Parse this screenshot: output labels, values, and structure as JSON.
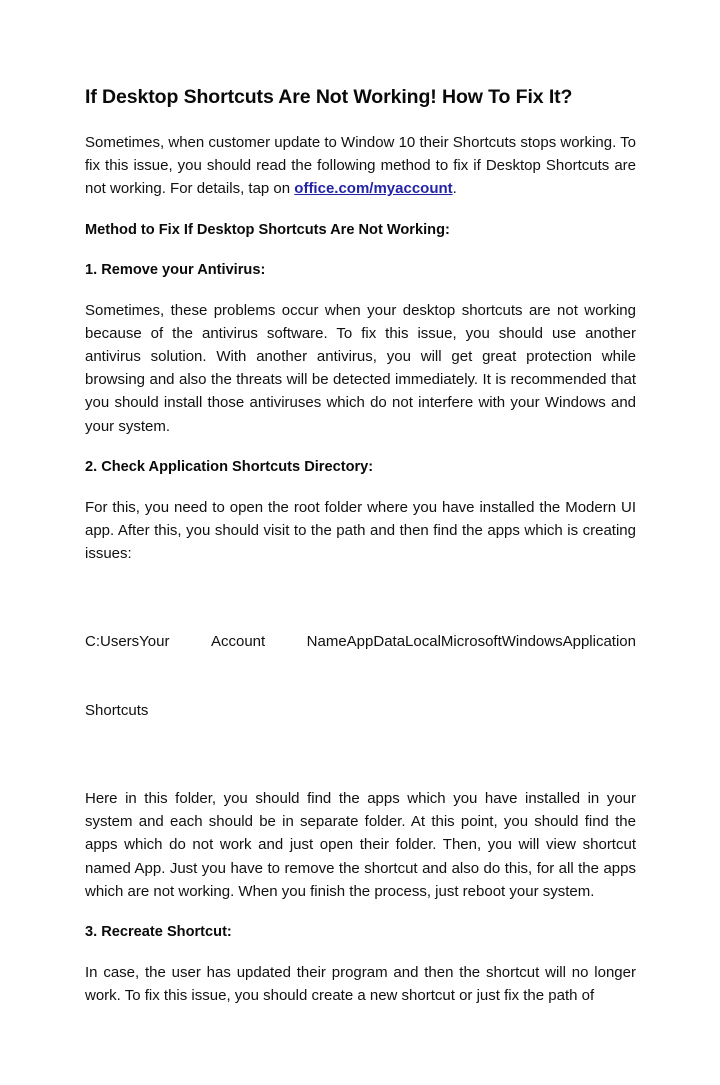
{
  "document": {
    "title": "If Desktop Shortcuts Are Not Working! How To Fix It?",
    "intro": {
      "text_before_link": "Sometimes, when customer update to Window 10 their Shortcuts stops working. To fix this issue, you should read the following method to fix if Desktop Shortcuts are not working. For details, tap on ",
      "link_text": "office.com/myaccount",
      "text_after_link": "."
    },
    "method_heading": "Method to Fix If Desktop Shortcuts Are Not Working:",
    "sections": [
      {
        "heading": "1. Remove your Antivirus:",
        "body": "Sometimes, these problems occur when your desktop shortcuts are not working because of the antivirus software. To fix this issue, you should use another antivirus solution. With another antivirus, you will get great protection while browsing and also the threats will be detected immediately. It is recommended that you should install those antiviruses which do not interfere with your Windows and your system."
      },
      {
        "heading": "2. Check Application Shortcuts Directory:",
        "body": "For this, you need to open the root folder where you have installed the Modern UI app. After this, you should visit to the path and then find the apps which is creating issues:",
        "path_segments": [
          "C:UsersYour",
          "Account",
          "NameAppDataLocalMicrosoftWindowsApplication"
        ],
        "path_continuation": "Shortcuts",
        "body_after": "Here in this folder, you should find the apps which you have installed in your system and each should be in separate folder. At this point, you should find the apps which do not work and just open their folder. Then, you will view shortcut named App. Just you have to remove the shortcut and also do this, for all the apps which are not working. When you finish the process, just reboot your system."
      },
      {
        "heading": "3. Recreate Shortcut:",
        "body": "In case, the user has updated their program and then the shortcut will no longer work. To fix this issue, you should create a new shortcut or just fix the path of"
      }
    ],
    "colors": {
      "text": "#111111",
      "link": "#2323a6",
      "background": "#ffffff"
    }
  }
}
